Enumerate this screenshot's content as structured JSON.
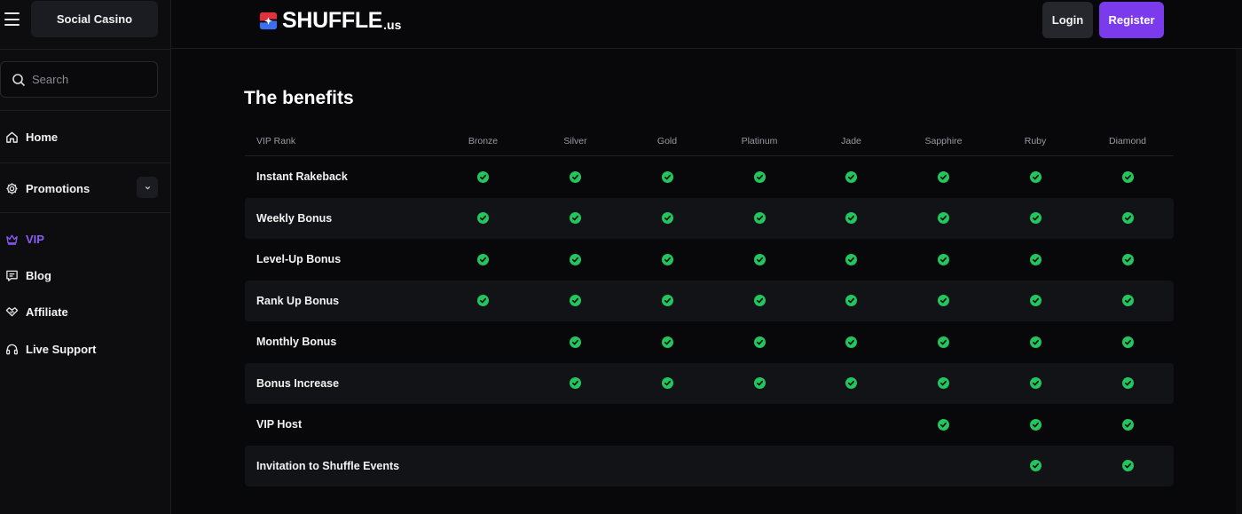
{
  "sidebar": {
    "social_casino": "Social Casino",
    "search_placeholder": "Search",
    "items": [
      {
        "label": "Home",
        "icon": "home-icon"
      },
      {
        "label": "Promotions",
        "icon": "gear-icon"
      },
      {
        "label": "VIP",
        "icon": "crown-icon"
      },
      {
        "label": "Blog",
        "icon": "chat-icon"
      },
      {
        "label": "Affiliate",
        "icon": "handshake-icon"
      },
      {
        "label": "Live Support",
        "icon": "headset-icon"
      }
    ]
  },
  "header": {
    "logo_text": "SHUFFLE",
    "logo_suffix": ".us",
    "login": "Login",
    "register": "Register"
  },
  "main": {
    "title": "The benefits",
    "table": {
      "rank_header": "VIP Rank",
      "ranks": [
        "Bronze",
        "Silver",
        "Gold",
        "Platinum",
        "Jade",
        "Sapphire",
        "Ruby",
        "Diamond"
      ],
      "rows": [
        {
          "label": "Instant Rakeback",
          "checks": [
            true,
            true,
            true,
            true,
            true,
            true,
            true,
            true
          ]
        },
        {
          "label": "Weekly Bonus",
          "checks": [
            true,
            true,
            true,
            true,
            true,
            true,
            true,
            true
          ]
        },
        {
          "label": "Level-Up Bonus",
          "checks": [
            true,
            true,
            true,
            true,
            true,
            true,
            true,
            true
          ]
        },
        {
          "label": "Rank Up Bonus",
          "checks": [
            true,
            true,
            true,
            true,
            true,
            true,
            true,
            true
          ]
        },
        {
          "label": "Monthly Bonus",
          "checks": [
            false,
            true,
            true,
            true,
            true,
            true,
            true,
            true
          ]
        },
        {
          "label": "Bonus Increase",
          "checks": [
            false,
            true,
            true,
            true,
            true,
            true,
            true,
            true
          ]
        },
        {
          "label": "VIP Host",
          "checks": [
            false,
            false,
            false,
            false,
            false,
            true,
            true,
            true
          ]
        },
        {
          "label": "Invitation to Shuffle Events",
          "checks": [
            false,
            false,
            false,
            false,
            false,
            false,
            true,
            true
          ]
        }
      ]
    }
  },
  "colors": {
    "accent": "#7c3aed",
    "vip_active": "#8b5cf6",
    "check": "#22c55e",
    "background": "#08080a"
  }
}
